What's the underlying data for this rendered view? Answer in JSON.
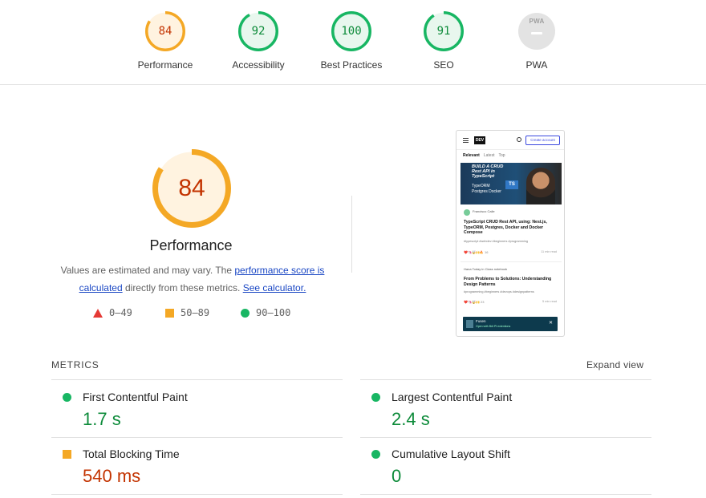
{
  "scores": [
    {
      "label": "Performance",
      "score": "84",
      "fraction": 0.84,
      "color": "#f4a825",
      "text_color": "#c33300",
      "bg": "#fff3e0"
    },
    {
      "label": "Accessibility",
      "score": "92",
      "fraction": 0.92,
      "color": "#18b663",
      "text_color": "#0d8b3a",
      "bg": "#e8f7ee"
    },
    {
      "label": "Best Practices",
      "score": "100",
      "fraction": 1.0,
      "color": "#18b663",
      "text_color": "#0d8b3a",
      "bg": "#e8f7ee"
    },
    {
      "label": "SEO",
      "score": "91",
      "fraction": 0.91,
      "color": "#18b663",
      "text_color": "#0d8b3a",
      "bg": "#e8f7ee"
    }
  ],
  "pwa": {
    "label": "PWA",
    "badge_text": "PWA"
  },
  "main_gauge": {
    "score": "84",
    "fraction": 0.84,
    "title": "Performance",
    "color": "#f4a825"
  },
  "description": {
    "text_1": "Values are estimated and may vary. The ",
    "link_1": "performance score is calculated",
    "text_2": " directly from these metrics. ",
    "link_2": "See calculator."
  },
  "legend": [
    {
      "shape": "triangle-icon",
      "range": "0–49",
      "color": "#e53935"
    },
    {
      "shape": "square-icon",
      "range": "50–89",
      "color": "#f4a825"
    },
    {
      "shape": "circle-icon",
      "range": "90–100",
      "color": "#18b663"
    }
  ],
  "thumbnail": {
    "logo": "DEV",
    "create_button": "Create account",
    "tabs": [
      "Relevant",
      "Latest",
      "Top"
    ],
    "hero_title": "BUILD A CRUD Rest API in TypeScript",
    "hero_sub": "TypeORM Postgres Docker",
    "hero_badge": "TS",
    "post1": {
      "author": "Francisco Calle",
      "title": "TypeScript CRUD Rest API, using: Nest.js, TypeORM, Postgres, Docker and Docker Compose",
      "tags": "#typescript  #webdev  #beginners  #programming",
      "reactions": "❤️🦄🤯🙌🔥 16",
      "read_time": "11 min read"
    },
    "post2": {
      "author": "Hana Today in Class notebook",
      "title": "From Problems to Solutions: Understanding Design Patterns",
      "tags": "#programming  #beginners  #devops  #designpatterns",
      "reactions": "❤️🦄🤯🙌 23",
      "read_time": "5 min read"
    },
    "toast": {
      "title": "Fusen",
      "subtitle": "Open with Brit Pt extentions"
    }
  },
  "metrics": {
    "heading": "METRICS",
    "expand_label": "Expand view",
    "items": [
      {
        "name": "First Contentful Paint",
        "value": "1.7 s",
        "status": "green"
      },
      {
        "name": "Largest Contentful Paint",
        "value": "2.4 s",
        "status": "green"
      },
      {
        "name": "Total Blocking Time",
        "value": "540 ms",
        "status": "orange"
      },
      {
        "name": "Cumulative Layout Shift",
        "value": "0",
        "status": "green"
      }
    ]
  }
}
